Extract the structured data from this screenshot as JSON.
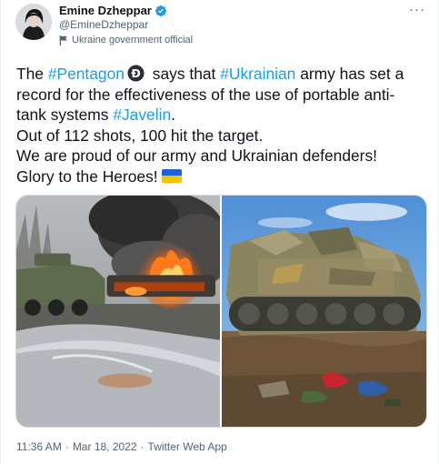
{
  "author": {
    "name": "Emine Dzheppar",
    "handle": "@EmineDzheppar",
    "label": "Ukraine government official"
  },
  "more_label": "···",
  "text": {
    "l1_a": "The ",
    "l1_tag1": "#Pentagon",
    "l1_b": " says that ",
    "l1_tag2": "#Ukrainian",
    "l1_c": " army has set a",
    "l2": "record for the effectiveness of the use of portable anti-",
    "l3_a": "tank systems ",
    "l3_tag": "#Javelin",
    "l3_b": ".",
    "l4": "Out of 112 shots, 100 hit the target.",
    "l5": "We are proud of our army and Ukrainian defenders!",
    "l6": "Glory to the Heroes!"
  },
  "meta": {
    "time": "11:36 AM",
    "sep1": "·",
    "date": "Mar 18, 2022",
    "sep2": "·",
    "app": "Twitter Web App"
  },
  "colors": {
    "link": "#1d9bf0",
    "verified": "#1d9bf0",
    "flag_blue": "#1a63d6",
    "flag_yellow": "#f5c400"
  },
  "icons": [
    "verified-badge-icon",
    "government-flag-icon",
    "pentagon-hashflag-icon",
    "ukraine-flag-emoji",
    "more-icon"
  ]
}
